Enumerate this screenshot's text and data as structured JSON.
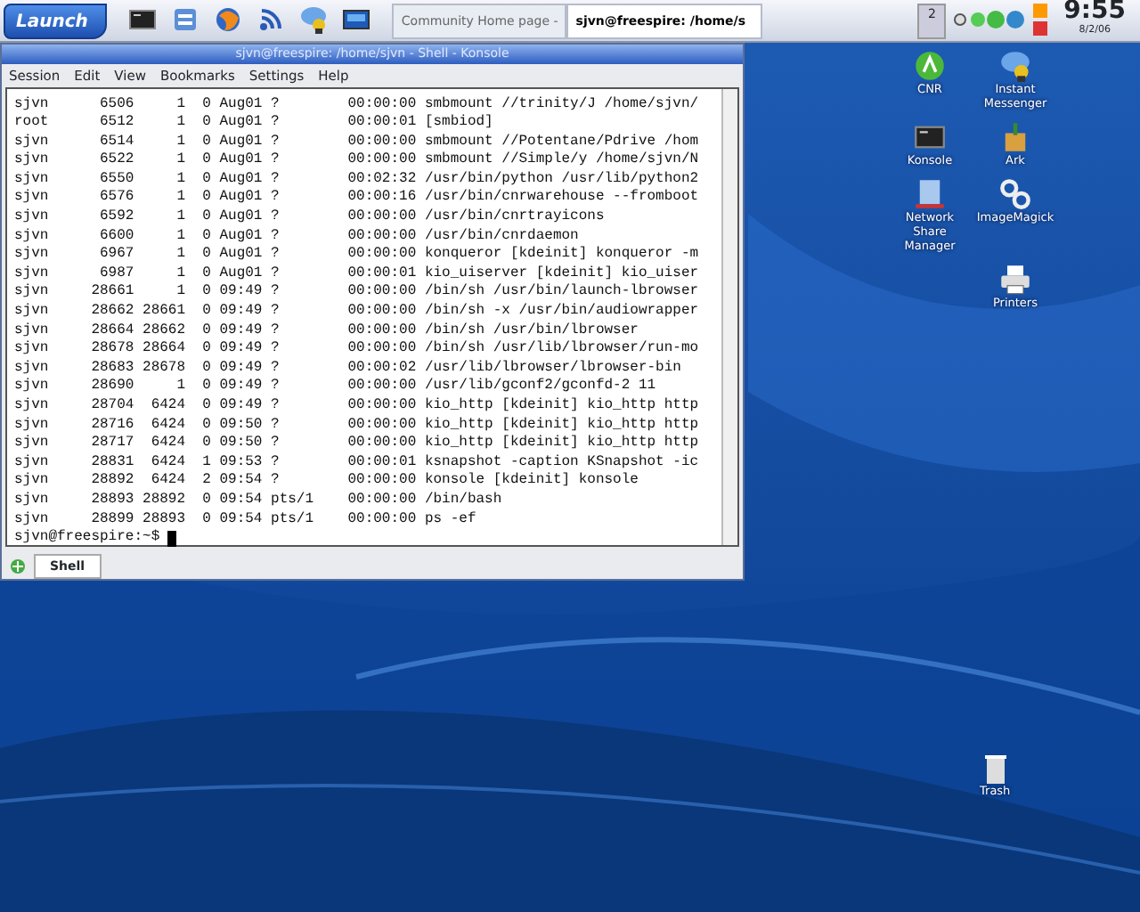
{
  "taskbar": {
    "launch": "Launch",
    "quick_launch": [
      {
        "kind": "terminal"
      },
      {
        "kind": "files"
      },
      {
        "kind": "browser"
      },
      {
        "kind": "feed"
      },
      {
        "kind": "messenger"
      },
      {
        "kind": "desktop"
      }
    ],
    "tasks": [
      {
        "label": "Community Home page -",
        "selected": false
      },
      {
        "label": "sjvn@freespire: /home/s",
        "selected": true
      }
    ],
    "pager": "2",
    "clock": "9:55",
    "date": "8/2/06"
  },
  "window": {
    "title": "sjvn@freespire: /home/sjvn - Shell - Konsole",
    "menu": [
      "Session",
      "Edit",
      "View",
      "Bookmarks",
      "Settings",
      "Help"
    ],
    "lines": [
      "sjvn      6506     1  0 Aug01 ?        00:00:00 smbmount //trinity/J /home/sjvn/",
      "root      6512     1  0 Aug01 ?        00:00:01 [smbiod]",
      "sjvn      6514     1  0 Aug01 ?        00:00:00 smbmount //Potentane/Pdrive /hom",
      "sjvn      6522     1  0 Aug01 ?        00:00:00 smbmount //Simple/y /home/sjvn/N",
      "sjvn      6550     1  0 Aug01 ?        00:02:32 /usr/bin/python /usr/lib/python2",
      "sjvn      6576     1  0 Aug01 ?        00:00:16 /usr/bin/cnrwarehouse --fromboot",
      "sjvn      6592     1  0 Aug01 ?        00:00:00 /usr/bin/cnrtrayicons",
      "sjvn      6600     1  0 Aug01 ?        00:00:00 /usr/bin/cnrdaemon",
      "sjvn      6967     1  0 Aug01 ?        00:00:00 konqueror [kdeinit] konqueror -m",
      "sjvn      6987     1  0 Aug01 ?        00:00:01 kio_uiserver [kdeinit] kio_uiser",
      "sjvn     28661     1  0 09:49 ?        00:00:00 /bin/sh /usr/bin/launch-lbrowser",
      "sjvn     28662 28661  0 09:49 ?        00:00:00 /bin/sh -x /usr/bin/audiowrapper",
      "sjvn     28664 28662  0 09:49 ?        00:00:00 /bin/sh /usr/bin/lbrowser",
      "sjvn     28678 28664  0 09:49 ?        00:00:00 /bin/sh /usr/lib/lbrowser/run-mo",
      "sjvn     28683 28678  0 09:49 ?        00:00:02 /usr/lib/lbrowser/lbrowser-bin",
      "sjvn     28690     1  0 09:49 ?        00:00:00 /usr/lib/gconf2/gconfd-2 11",
      "sjvn     28704  6424  0 09:49 ?        00:00:00 kio_http [kdeinit] kio_http http",
      "sjvn     28716  6424  0 09:50 ?        00:00:00 kio_http [kdeinit] kio_http http",
      "sjvn     28717  6424  0 09:50 ?        00:00:00 kio_http [kdeinit] kio_http http",
      "sjvn     28831  6424  1 09:53 ?        00:00:01 ksnapshot -caption KSnapshot -ic",
      "sjvn     28892  6424  2 09:54 ?        00:00:00 konsole [kdeinit] konsole",
      "sjvn     28893 28892  0 09:54 pts/1    00:00:00 /bin/bash",
      "sjvn     28899 28893  0 09:54 pts/1    00:00:00 ps -ef"
    ],
    "prompt": "sjvn@freespire:~$",
    "tabs": [
      {
        "label": "Shell",
        "selected": true
      }
    ]
  },
  "desktop_icons": [
    {
      "label": "CNR",
      "kind": "cnr"
    },
    {
      "label": "Instant Messenger",
      "kind": "messenger"
    },
    {
      "label": "Konsole",
      "kind": "terminal"
    },
    {
      "label": "Ark",
      "kind": "archive"
    },
    {
      "label": "Network Share Manager",
      "kind": "network"
    },
    {
      "label": "ImageMagick",
      "kind": "gears"
    },
    {
      "kind": "none"
    },
    {
      "label": "Printers",
      "kind": "printer"
    }
  ],
  "trash": {
    "label": "Trash"
  }
}
